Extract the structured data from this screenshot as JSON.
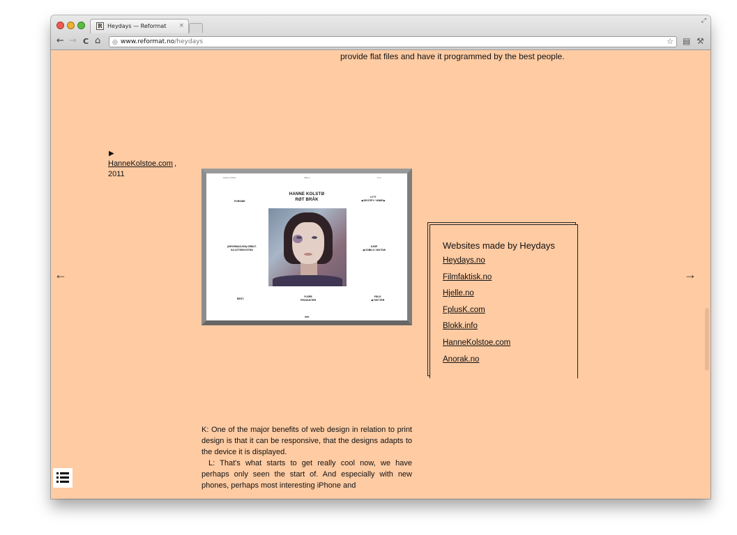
{
  "browser": {
    "tab_title": "Heydays — Reformat",
    "tab_favicon": "R",
    "tab_close": "×",
    "url_host": "www.reformat.no",
    "url_path": "/heydays",
    "icons": {
      "back": "←",
      "forward": "→",
      "reload": "C",
      "home": "⌂",
      "bookmark_star": "☆",
      "page_menu": "▤",
      "wrench": "⚒",
      "fullscreen": "⤢",
      "globe": "◎"
    },
    "traffic_lights": {
      "close": "#ee5a52",
      "minimize": "#f3b02f",
      "zoom": "#5bbd3f"
    }
  },
  "page": {
    "background": "#fecba3",
    "intro_text": "provide flat files and have it programmed by the best people.",
    "play_icon": "▶",
    "caption": {
      "link": "HanneKolstoe.com",
      "comma": ",",
      "year": "2011"
    },
    "screenshot": {
      "top_labels": [
        "Hanne Kolstø",
        "Album",
        "Live"
      ],
      "title_line1": "HANNE KOLSTØ",
      "title_line2": "RØT BRÅK",
      "left_top": "FORSIDE",
      "right_top": "LYTT\n◀ SPOTIFY / WIMP ▶",
      "left_mid": "(INFORMASJON) DEBUT.\nS/4 ATTERDYSTEN",
      "right_mid": "KJØP\n◀ CDBILS / MOTSW",
      "bottom_left": "BEST.",
      "bottom_center": "FLERE\nPRODUKTER",
      "bottom_right": "FØLG\n◀ TWITTER",
      "footer": "info"
    },
    "sites_box": {
      "title": "Websites made by Heydays",
      "links": [
        "Heydays.no",
        "Filmfaktisk.no",
        "Hjelle.no",
        "FplusK.com",
        "Blokk.info",
        "HanneKolstoe.com",
        "Anorak.no"
      ]
    },
    "prev_arrow": "←",
    "next_arrow": "→",
    "article": {
      "p1": "K: One of the major benefits of web design in relation to print design is that it can be responsive, that the designs adapts to the device it is displayed.",
      "p2": "L: That's what starts to get really cool now, we have perhaps only seen the start of. And especially with new phones, perhaps most interesting iPhone and"
    }
  }
}
